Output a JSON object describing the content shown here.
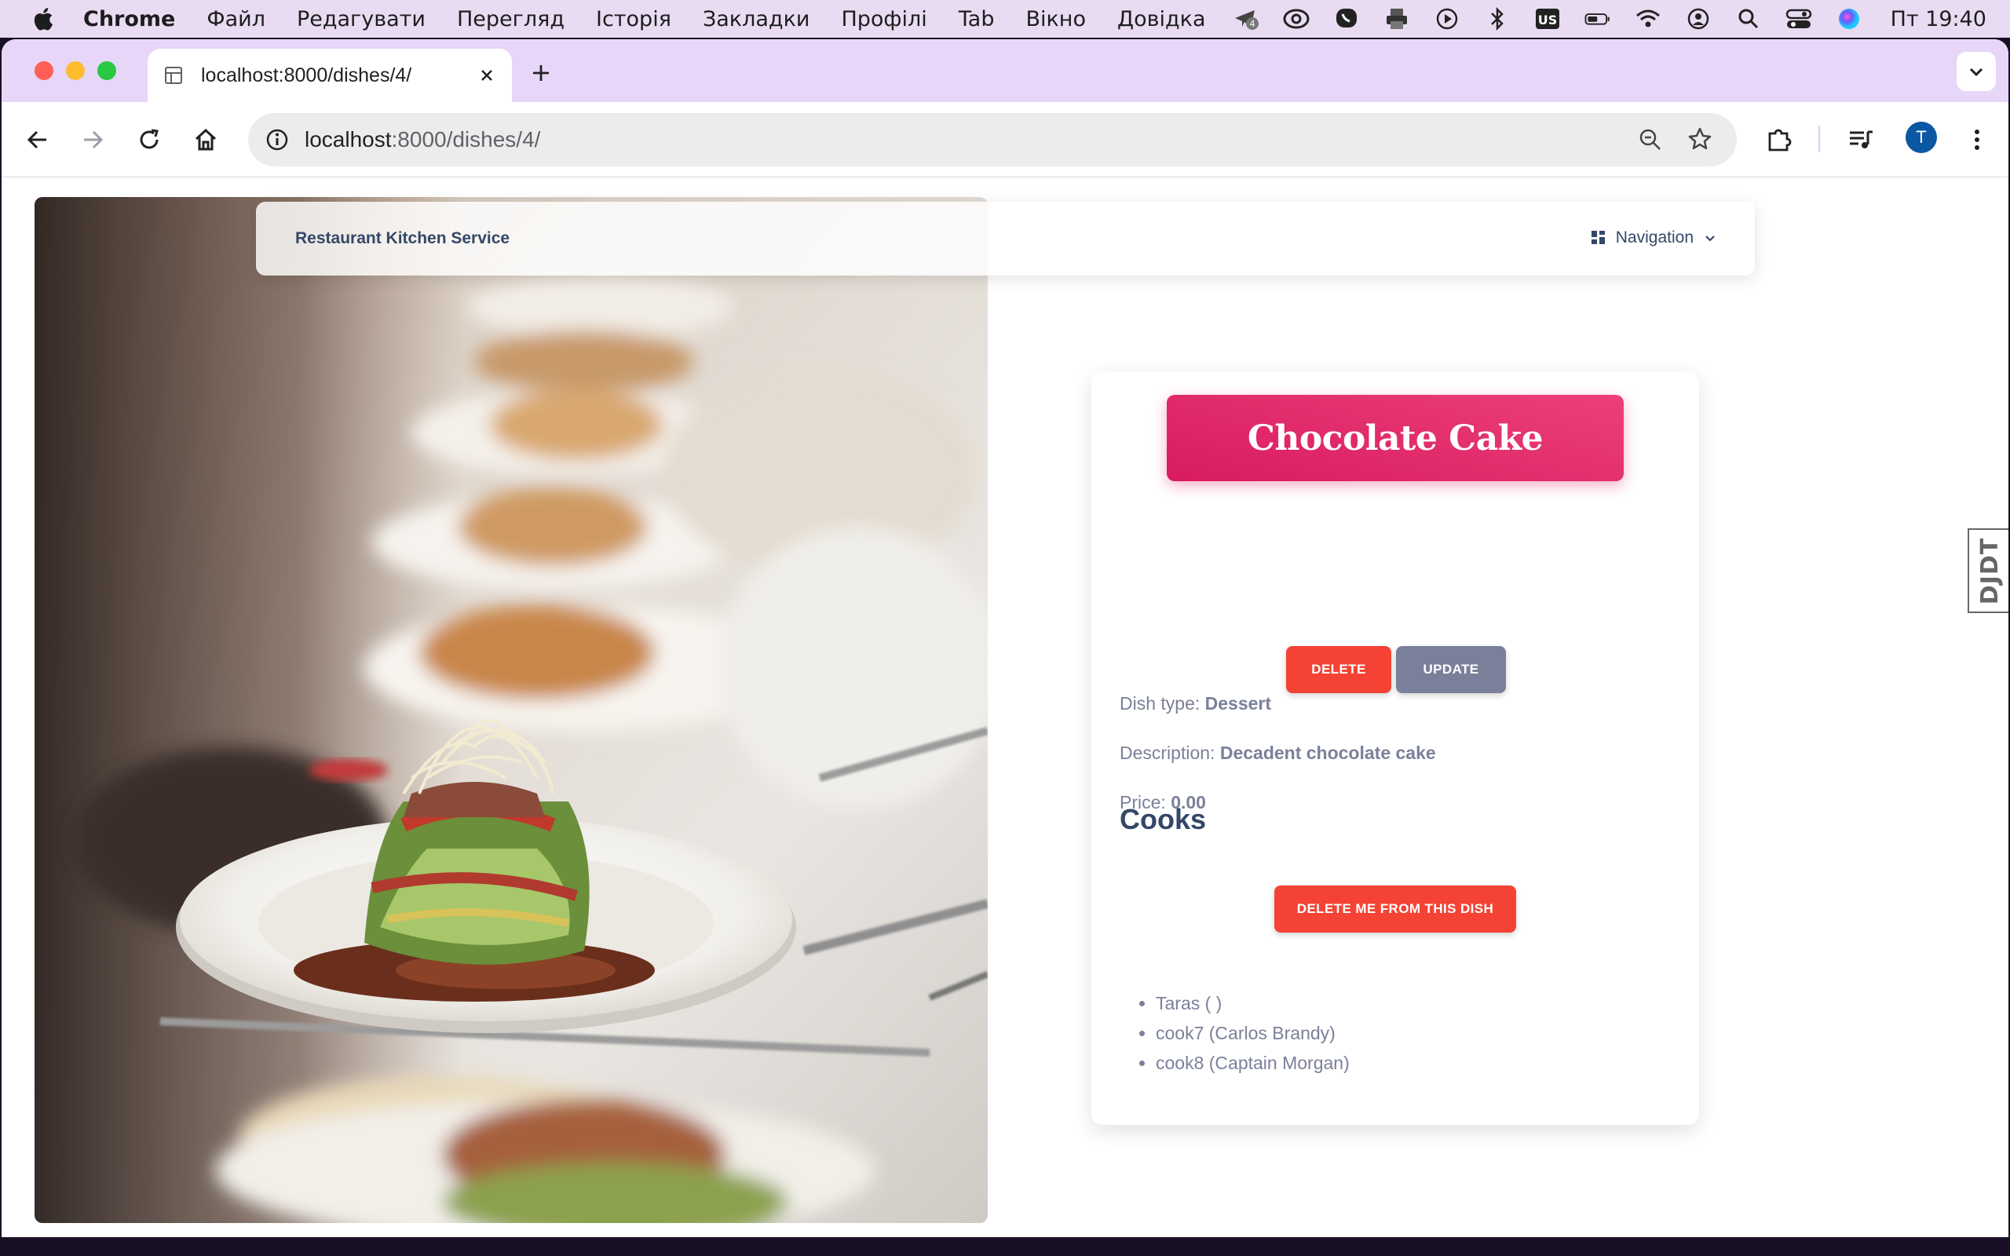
{
  "menubar": {
    "app": "Chrome",
    "items": [
      "Файл",
      "Редагувати",
      "Перегляд",
      "Історія",
      "Закладки",
      "Профілі",
      "Tab",
      "Вікно",
      "Довідка"
    ],
    "keyboard_layout": "US",
    "clock": "Пт  19:40",
    "telegram_badge": "4"
  },
  "browser": {
    "tab_title": "localhost:8000/dishes/4/",
    "url_host": "localhost",
    "url_rest": ":8000/dishes/4/",
    "profile_initial": "T"
  },
  "page": {
    "brand": "Restaurant Kitchen Service",
    "nav_label": "Navigation",
    "dish_name": "Chocolate Cake",
    "delete_label": "DELETE",
    "update_label": "UPDATE",
    "dish_type_label": "Dish type:",
    "dish_type": "Dessert",
    "description_label": "Description:",
    "description": "Decadent chocolate cake",
    "price_label": "Price:",
    "price": "0.00",
    "cooks_title": "Cooks",
    "delete_me_label": "DELETE ME FROM THIS DISH",
    "cooks": [
      "Taras ( )",
      "cook7 (Carlos Brandy)",
      "cook8 (Captain Morgan)"
    ]
  },
  "debug_toolbar": {
    "label": "DJDT"
  },
  "colors": {
    "accent_pink": "#e91e63",
    "danger": "#f44335",
    "secondary": "#7b809a",
    "heading": "#344767"
  }
}
